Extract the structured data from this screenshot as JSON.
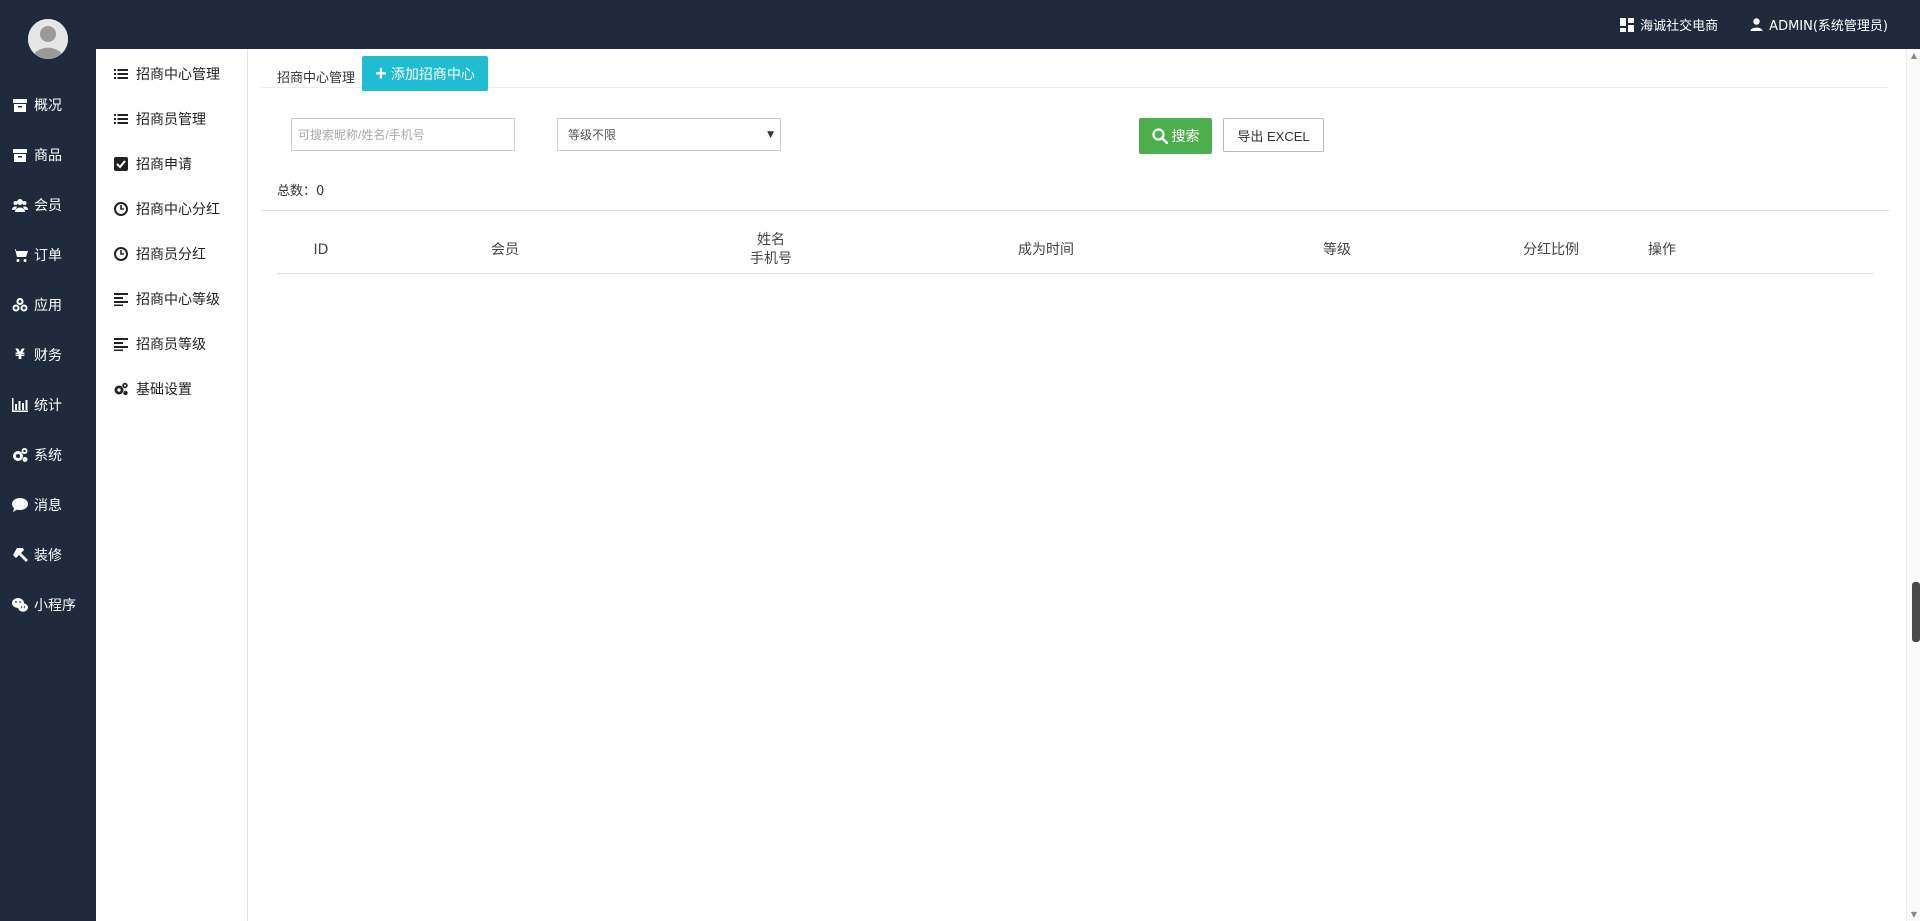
{
  "header": {
    "shop_name": "海诚社交电商",
    "user_name": "ADMIN(系统管理员)"
  },
  "sidenav": {
    "items": [
      {
        "label": "概况",
        "icon": "archive-icon"
      },
      {
        "label": "商品",
        "icon": "archive-icon"
      },
      {
        "label": "会员",
        "icon": "users-icon"
      },
      {
        "label": "订单",
        "icon": "cart-icon"
      },
      {
        "label": "应用",
        "icon": "cubes-icon"
      },
      {
        "label": "财务",
        "icon": "yen-icon"
      },
      {
        "label": "统计",
        "icon": "bar-chart-icon"
      },
      {
        "label": "系统",
        "icon": "gears-icon"
      },
      {
        "label": "消息",
        "icon": "chat-icon"
      },
      {
        "label": "装修",
        "icon": "hammer-icon"
      },
      {
        "label": "小程序",
        "icon": "wechat-icon"
      }
    ]
  },
  "submenu": {
    "items": [
      {
        "label": "招商中心管理",
        "icon": "list-icon"
      },
      {
        "label": "招商员管理",
        "icon": "list-icon"
      },
      {
        "label": "招商申请",
        "icon": "checkbox-icon"
      },
      {
        "label": "招商中心分红",
        "icon": "clock-icon"
      },
      {
        "label": "招商员分红",
        "icon": "clock-icon"
      },
      {
        "label": "招商中心等级",
        "icon": "align-left-icon"
      },
      {
        "label": "招商员等级",
        "icon": "align-left-icon"
      },
      {
        "label": "基础设置",
        "icon": "gears-icon"
      }
    ]
  },
  "main": {
    "breadcrumb": "招商中心管理",
    "add_button": "添加招商中心",
    "search_placeholder": "可搜索昵称/姓名/手机号",
    "level_select_value": "等级不限",
    "search_button": "搜索",
    "export_button": "导出 EXCEL",
    "total_label": "总数：",
    "total_value": "0"
  },
  "table": {
    "headers": {
      "id": "ID",
      "member": "会员",
      "name": "姓名",
      "phone": "手机号",
      "became_time": "成为时间",
      "level": "等级",
      "dividend_ratio": "分红比例",
      "actions": "操作"
    }
  },
  "colors": {
    "sidebar_bg": "#1f2b3c",
    "add_button": "#1fbcd2",
    "search_button": "#4cae4c"
  }
}
